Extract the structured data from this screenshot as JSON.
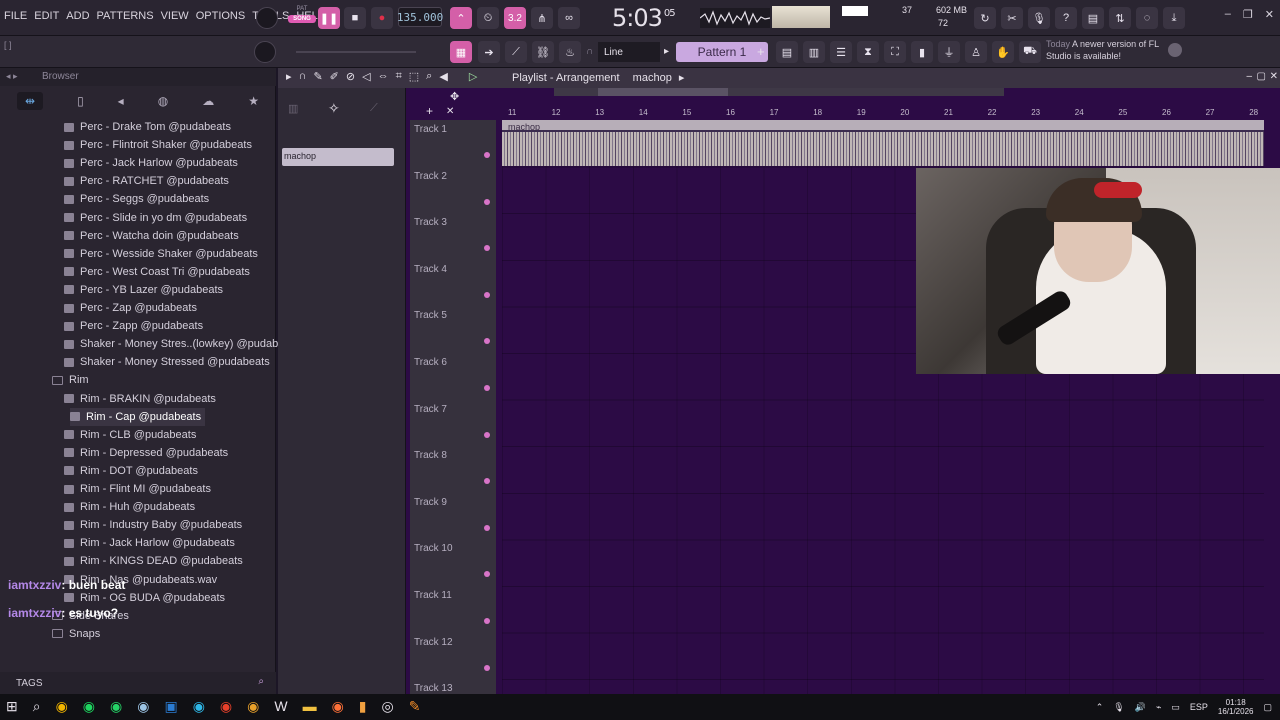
{
  "menu": [
    "FILE",
    "EDIT",
    "ADD",
    "PATTERNS",
    "VIEW",
    "OPTIONS",
    "TOOLS",
    "HELP"
  ],
  "transport": {
    "mode_top": "PAT",
    "mode_active": "SONG",
    "bpm": "135.000",
    "time": "5:03",
    "time_frac": "05",
    "step_label": "3.2"
  },
  "monitor": {
    "cpu_val": "37",
    "mem": "602 MB",
    "poly": "72"
  },
  "toolbar2": {
    "hint": "[ ]",
    "snap": "Line",
    "pattern": "Pattern 1",
    "update_title": "Today",
    "update_msg": "A newer version of FL Studio is available!"
  },
  "browser": {
    "title": "Browser",
    "items": [
      {
        "label": "Perc - Drake Tom @pudabeats",
        "kind": "file"
      },
      {
        "label": "Perc - Flintroit Shaker @pudabeats",
        "kind": "file"
      },
      {
        "label": "Perc - Jack Harlow @pudabeats",
        "kind": "file"
      },
      {
        "label": "Perc - RATCHET @pudabeats",
        "kind": "file"
      },
      {
        "label": "Perc - Seggs @pudabeats",
        "kind": "file"
      },
      {
        "label": "Perc - Slide in yo dm @pudabeats",
        "kind": "file"
      },
      {
        "label": "Perc - Watcha doin @pudabeats",
        "kind": "file"
      },
      {
        "label": "Perc - Wesside Shaker @pudabeats",
        "kind": "file"
      },
      {
        "label": "Perc - West Coast Tri @pudabeats",
        "kind": "file"
      },
      {
        "label": "Perc - YB Lazer @pudabeats",
        "kind": "file"
      },
      {
        "label": "Perc - Zap @pudabeats",
        "kind": "file"
      },
      {
        "label": "Perc - Zapp @pudabeats",
        "kind": "file"
      },
      {
        "label": "Shaker - Money Stres..(lowkey) @pudabeats",
        "kind": "file"
      },
      {
        "label": "Shaker - Money Stressed @pudabeats",
        "kind": "file"
      },
      {
        "label": "Rim",
        "kind": "folder"
      },
      {
        "label": "Rim - BRAKIN @pudabeats",
        "kind": "file"
      },
      {
        "label": "Rim - Cap @pudabeats",
        "kind": "selected"
      },
      {
        "label": "Rim - CLB @pudabeats",
        "kind": "file"
      },
      {
        "label": "Rim - Depressed @pudabeats",
        "kind": "file"
      },
      {
        "label": "Rim - DOT @pudabeats",
        "kind": "file"
      },
      {
        "label": "Rim - Flint MI @pudabeats",
        "kind": "file"
      },
      {
        "label": "Rim - Huh @pudabeats",
        "kind": "file"
      },
      {
        "label": "Rim - Industry Baby @pudabeats",
        "kind": "file"
      },
      {
        "label": "Rim - Jack Harlow @pudabeats",
        "kind": "file"
      },
      {
        "label": "Rim - KINGS DEAD @pudabeats",
        "kind": "file"
      },
      {
        "label": "Rim - Nas @pudabeats.wav",
        "kind": "file"
      },
      {
        "label": "Rim - OG BUDA @pudabeats",
        "kind": "file"
      },
      {
        "label": "Side Snares",
        "kind": "folder"
      },
      {
        "label": "Snaps",
        "kind": "folder"
      }
    ],
    "tags": "TAGS"
  },
  "chat": [
    {
      "user": "iamtxzziv",
      "msg": ": buen beat"
    },
    {
      "user": "iamtxzziv",
      "msg": ": es tuyo?"
    }
  ],
  "playlist": {
    "title": "Playlist - Arrangement",
    "pattern_name": "machop",
    "picker_item": "machop",
    "clip_label": "machop",
    "ruler": [
      "11",
      "12",
      "13",
      "14",
      "15",
      "16",
      "17",
      "18",
      "19",
      "20",
      "21",
      "22",
      "23",
      "24",
      "25",
      "26",
      "27",
      "28"
    ],
    "tracks": [
      "Track 1",
      "Track 2",
      "Track 3",
      "Track 4",
      "Track 5",
      "Track 6",
      "Track 7",
      "Track 8",
      "Track 9",
      "Track 10",
      "Track 11",
      "Track 12",
      "Track 13"
    ]
  },
  "taskbar": {
    "lang": "ESP",
    "time": "01:18",
    "date": "16/1/2026"
  },
  "colors": {
    "accent_pink": "#d45fa8",
    "playlist_bg": "#2c0b45",
    "pattern_lilac": "#c9a8e0"
  }
}
